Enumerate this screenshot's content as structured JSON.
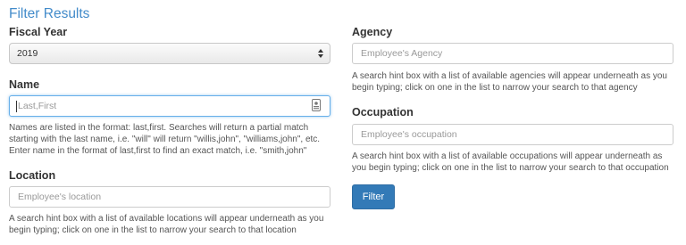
{
  "page": {
    "title": "Filter Results"
  },
  "fiscal_year": {
    "label": "Fiscal Year",
    "selected": "2019"
  },
  "name": {
    "label": "Name",
    "placeholder": "Last,First",
    "help": "Names are listed in the format: last,first. Searches will return a partial match starting with the last name, i.e. \"will\" will return \"willis,john\", \"williams,john\", etc. Enter name in the format of last,first to find an exact match, i.e. \"smith,john\""
  },
  "location": {
    "label": "Location",
    "placeholder": "Employee's location",
    "help": "A search hint box with a list of available locations will appear underneath as you begin typing; click on one in the list to narrow your search to that location"
  },
  "agency": {
    "label": "Agency",
    "placeholder": "Employee's Agency",
    "help": "A search hint box with a list of available agencies will appear underneath as you begin typing; click on one in the list to narrow your search to that agency"
  },
  "occupation": {
    "label": "Occupation",
    "placeholder": "Employee's occupation",
    "help": "A search hint box with a list of available occupations will appear underneath as you begin typing; click on one in the list to narrow your search to that occupation"
  },
  "filter_button": {
    "label": "Filter"
  },
  "colors": {
    "title": "#428bca",
    "button": "#337ab7",
    "focus_border": "#66afe9"
  },
  "icons": {
    "select_arrows": "updown-arrows-icon",
    "name_field_icon": "contact-card-icon"
  }
}
